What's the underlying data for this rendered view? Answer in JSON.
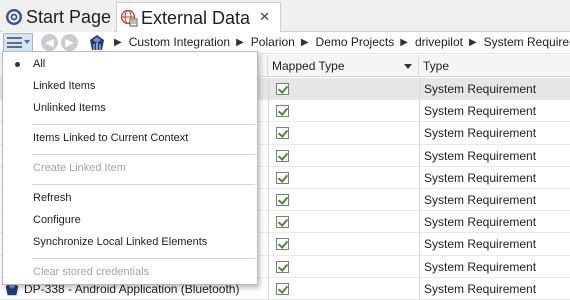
{
  "tabs": [
    {
      "label": "Start Page",
      "icon": "start-page-icon"
    },
    {
      "label": "External Data",
      "icon": "external-data-globe-icon",
      "close_icon": "close-icon"
    }
  ],
  "toolbar": {
    "menu_icon": "hamburger-menu-icon",
    "back_icon": "back-arrow-icon",
    "forward_icon": "forward-arrow-icon",
    "breadcrumb_logo_icon": "polarion-logo-icon",
    "breadcrumbs": [
      "Custom Integration",
      "Polarion",
      "Demo Projects",
      "drivepilot",
      "System Requirement"
    ],
    "separator": "▶"
  },
  "grid": {
    "columns": [
      {
        "label": ""
      },
      {
        "label": "Mapped Type"
      },
      {
        "label": "Type"
      }
    ],
    "rows": [
      {
        "name": "",
        "mapped": true,
        "type": "System Requirement",
        "selected": true
      },
      {
        "name": "",
        "mapped": true,
        "type": "System Requirement"
      },
      {
        "name": "",
        "mapped": true,
        "type": "System Requirement"
      },
      {
        "name": "",
        "mapped": true,
        "type": "System Requirement"
      },
      {
        "name": "",
        "mapped": true,
        "type": "System Requirement"
      },
      {
        "name": "",
        "mapped": true,
        "type": "System Requirement"
      },
      {
        "name": "",
        "mapped": true,
        "type": "System Requirement"
      },
      {
        "name": "",
        "mapped": true,
        "type": "System Requirement"
      },
      {
        "name": "",
        "mapped": true,
        "type": "System Requirement"
      },
      {
        "name": "DP-338 - Android Application (Bluetooth)",
        "mapped": true,
        "type": "System Requirement"
      }
    ]
  },
  "menu": {
    "items": [
      {
        "label": "All",
        "checked": true,
        "disabled": false
      },
      {
        "label": "Linked Items",
        "disabled": false
      },
      {
        "label": "Unlinked Items",
        "disabled": false
      },
      {
        "label": "Items Linked to Current Context",
        "disabled": false
      },
      {
        "label": "Create Linked Item",
        "disabled": true
      },
      {
        "label": "Refresh",
        "disabled": false
      },
      {
        "label": "Configure",
        "disabled": false
      },
      {
        "label": "Synchronize Local Linked Elements",
        "disabled": false
      },
      {
        "label": "Clear stored credentials",
        "disabled": true
      }
    ]
  },
  "colors": {
    "accent": "#d6e4f3",
    "selected_row": "#e6e6e6",
    "disabled_text": "#a4a4a4",
    "check_green": "#4c8a2f"
  }
}
